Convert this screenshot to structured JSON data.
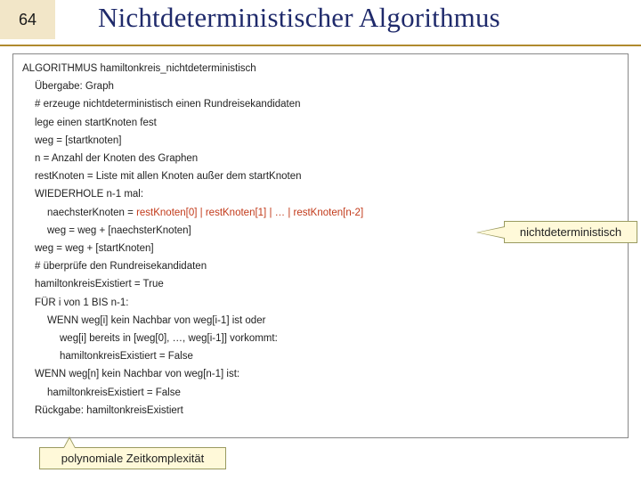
{
  "slide_number": "64",
  "title": "Nichtdeterministischer Algorithmus",
  "algo": {
    "l0": "ALGORITHMUS hamiltonkreis_nichtdeterministisch",
    "l1": "Übergabe: Graph",
    "l2": "# erzeuge nichtdeterministisch einen Rundreisekandidaten",
    "l3": "lege einen startKnoten fest",
    "l4": "weg = [startknoten]",
    "l5": "n = Anzahl der Knoten des Graphen",
    "l6": "restKnoten = Liste mit allen Knoten außer dem startKnoten",
    "l7": "WIEDERHOLE n-1 mal:",
    "l8a": "naechsterKnoten = ",
    "l8b": "restKnoten[0] | restKnoten[1] | … | restKnoten[n-2]",
    "l9": "weg = weg + [naechsterKnoten]",
    "l10": "weg = weg + [startKnoten]",
    "l11": "# überprüfe den Rundreisekandidaten",
    "l12": "hamiltonkreisExistiert = True",
    "l13": "FÜR i von 1 BIS n-1:",
    "l14": "WENN weg[i] kein Nachbar von weg[i-1] ist oder",
    "l15": "weg[i] bereits in [weg[0], …, weg[i-1]] vorkommt:",
    "l16": "hamiltonkreisExistiert = False",
    "l17": "WENN weg[n] kein Nachbar von weg[n-1] ist:",
    "l18": "hamiltonkreisExistiert = False",
    "l19": "Rückgabe: hamiltonkreisExistiert"
  },
  "callouts": {
    "right": "nichtdeterministisch",
    "bottom": "polynomiale Zeitkomplexität"
  }
}
